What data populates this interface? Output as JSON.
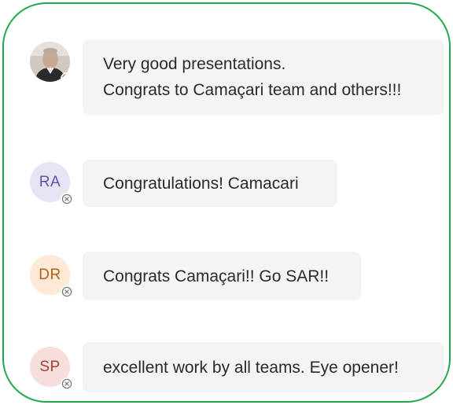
{
  "messages": [
    {
      "avatar": {
        "type": "photo",
        "initials": ""
      },
      "text_lines": [
        "Very good presentations.",
        "Congrats to Camaçari team and others!!!"
      ]
    },
    {
      "avatar": {
        "type": "initials",
        "initials": "RA",
        "bg": "#e6e3f3",
        "fg": "#5b57a6"
      },
      "text_lines": [
        "Congratulations! Camacari"
      ]
    },
    {
      "avatar": {
        "type": "initials",
        "initials": "DR",
        "bg": "#fde9d6",
        "fg": "#b0611a"
      },
      "text_lines": [
        "Congrats Camaçari!! Go SAR!!"
      ]
    },
    {
      "avatar": {
        "type": "initials",
        "initials": "SP",
        "bg": "#f6dedc",
        "fg": "#a3403a"
      },
      "text_lines": [
        "excellent work by all teams. Eye opener!"
      ]
    }
  ],
  "colors": {
    "frame_border": "#22a94a",
    "bubble_bg": "#f4f4f4",
    "text": "#2a2a2a",
    "presence_icon": "#7a7a7a"
  },
  "icons": {
    "presence": "offline-presence-icon"
  }
}
